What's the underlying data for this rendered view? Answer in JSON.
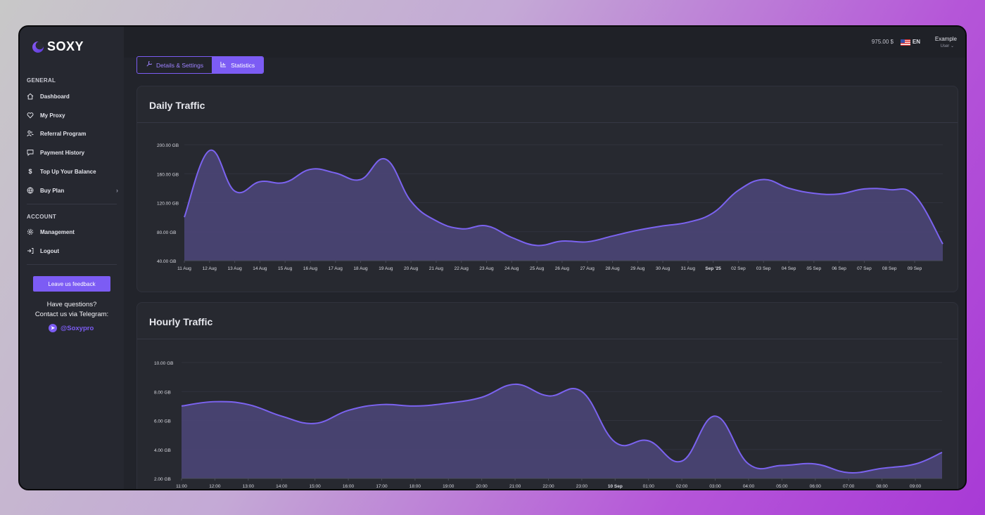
{
  "brand": {
    "name": "SOXY"
  },
  "sidebar": {
    "general_label": "GENERAL",
    "items": [
      {
        "label": "Dashboard",
        "icon": "home-icon"
      },
      {
        "label": "My Proxy",
        "icon": "heart-icon"
      },
      {
        "label": "Referral Program",
        "icon": "users-icon"
      },
      {
        "label": "Payment History",
        "icon": "message-icon"
      },
      {
        "label": "Top Up Your Balance",
        "icon": "dollar-icon"
      },
      {
        "label": "Buy Plan",
        "icon": "globe-icon"
      }
    ],
    "account_label": "ACCOUNT",
    "account_items": [
      {
        "label": "Management",
        "icon": "gear-icon"
      },
      {
        "label": "Logout",
        "icon": "logout-icon"
      }
    ],
    "feedback_button": "Leave us feedback",
    "help_line1": "Have questions?",
    "help_line2": "Contact us via Telegram:",
    "telegram_handle": "@Soxypro"
  },
  "topbar": {
    "balance": "975.00 $",
    "language": "EN",
    "user_name": "Example",
    "user_role": "User"
  },
  "tabs": [
    {
      "label": "Details & Settings",
      "active": false
    },
    {
      "label": "Statistics",
      "active": true
    }
  ],
  "colors": {
    "accent": "#7c5cf4",
    "line": "#7b63f0",
    "fill": "#4e477a",
    "background": "#22242b",
    "card": "#272930"
  },
  "chart_data": [
    {
      "type": "area",
      "title": "Daily Traffic",
      "ylim": [
        40,
        200
      ],
      "yticks": [
        "200.00 GB",
        "160.00 GB",
        "120.00 GB",
        "80.00 GB",
        "40.00 GB"
      ],
      "ytick_values": [
        200,
        160,
        120,
        80,
        40
      ],
      "categories": [
        "11 Aug",
        "12 Aug",
        "13 Aug",
        "14 Aug",
        "15 Aug",
        "16 Aug",
        "17 Aug",
        "18 Aug",
        "19 Aug",
        "20 Aug",
        "21 Aug",
        "22 Aug",
        "23 Aug",
        "24 Aug",
        "25 Aug",
        "26 Aug",
        "27 Aug",
        "28 Aug",
        "29 Aug",
        "30 Aug",
        "31 Aug",
        "Sep '25",
        "02 Sep",
        "03 Sep",
        "04 Sep",
        "05 Sep",
        "06 Sep",
        "07 Sep",
        "08 Sep",
        "09 Sep"
      ],
      "bold_tick": "Sep '25",
      "series": [
        {
          "values": [
            100,
            192,
            136,
            149,
            148,
            166,
            161,
            152,
            180,
            122,
            95,
            84,
            88,
            72,
            61,
            67,
            66,
            74,
            82,
            88,
            93,
            106,
            137,
            152,
            140,
            133,
            132,
            139,
            138,
            130
          ],
          "end_value": 63
        }
      ]
    },
    {
      "type": "area",
      "title": "Hourly Traffic",
      "ylim": [
        2,
        10
      ],
      "yticks": [
        "10.00 GB",
        "8.00 GB",
        "6.00 GB",
        "4.00 GB",
        "2.00 GB"
      ],
      "ytick_values": [
        10,
        8,
        6,
        4,
        2
      ],
      "categories": [
        "11:00",
        "12:00",
        "13:00",
        "14:00",
        "15:00",
        "16:00",
        "17:00",
        "18:00",
        "19:00",
        "20:00",
        "21:00",
        "22:00",
        "23:00",
        "10 Sep",
        "01:00",
        "02:00",
        "03:00",
        "04:00",
        "05:00",
        "06:00",
        "07:00",
        "08:00",
        "09:00"
      ],
      "bold_tick": "10 Sep",
      "series": [
        {
          "values": [
            7.0,
            7.3,
            7.1,
            6.3,
            5.8,
            6.7,
            7.1,
            7.0,
            7.2,
            7.6,
            8.5,
            7.7,
            8.0,
            4.5,
            4.6,
            3.2,
            6.3,
            3.0,
            2.9,
            3.0,
            2.4,
            2.7,
            3.0
          ],
          "end_value": 3.8
        }
      ]
    }
  ]
}
